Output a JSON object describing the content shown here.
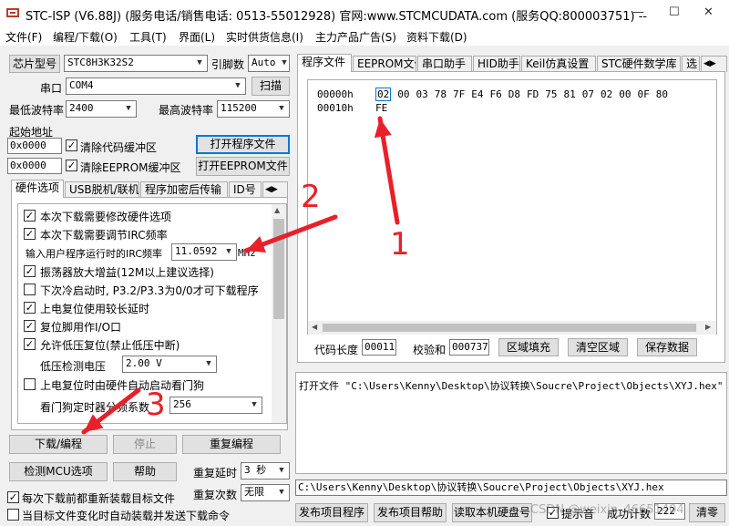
{
  "window": {
    "title": "STC-ISP (V6.88J) (服务电话/销售电话: 0513-55012928) 官网:www.STCMCUDATA.com (服务QQ:800003751) -- ",
    "minimize": "—",
    "maximize": "☐",
    "close": "✕"
  },
  "menu": [
    "文件(F)",
    "编程/下载(O)",
    "工具(T)",
    "界面(L)",
    "实时供货信息(I)",
    "主力产品广告(S)",
    "资料下载(D)"
  ],
  "left": {
    "chip_model_btn": "芯片型号",
    "chip_model_value": "STC8H3K32S2",
    "pin_count_label": "引脚数",
    "pin_count_value": "Auto",
    "port_label": "串口",
    "port_value": "COM4",
    "scan_btn": "扫描",
    "min_baud_label": "最低波特率",
    "min_baud_value": "2400",
    "max_baud_label": "最高波特率",
    "max_baud_value": "115200",
    "start_addr_label": "起始地址",
    "addr1": "0x0000",
    "clear_code_label": "清除代码缓冲区",
    "open_prog_btn": "打开程序文件",
    "addr2": "0x0000",
    "clear_eeprom_label": "清除EEPROM缓冲区",
    "open_eeprom_btn": "打开EEPROM文件",
    "tabs": [
      "硬件选项",
      "USB脱机/联机",
      "程序加密后传输",
      "ID号"
    ],
    "options": [
      {
        "label": "本次下载需要修改硬件选项",
        "checked": true
      },
      {
        "label": "本次下载需要调节IRC频率",
        "checked": true
      }
    ],
    "irc_label": "输入用户程序运行时的IRC频率",
    "irc_value": "11.0592",
    "irc_unit": "MHz",
    "options2": [
      {
        "label": "振荡器放大增益(12M以上建议选择)",
        "checked": true
      },
      {
        "label": "下次冷启动时, P3.2/P3.3为0/0才可下载程序",
        "checked": false
      },
      {
        "label": "上电复位使用较长延时",
        "checked": true
      },
      {
        "label": "复位脚用作I/O口",
        "checked": true
      },
      {
        "label": "允许低压复位(禁止低压中断)",
        "checked": true
      }
    ],
    "lvd_label": "低压检测电压",
    "lvd_value": "2.00 V",
    "wdt_option": {
      "label": "上电复位时由硬件自动启动看门狗",
      "checked": false
    },
    "wdt_div_label": "看门狗定时器分频系数",
    "wdt_div_value": "256",
    "download_btn": "下载/编程",
    "stop_btn": "停止",
    "reprogram_btn": "重复编程",
    "detect_btn": "检测MCU选项",
    "help_btn": "帮助",
    "repeat_delay_label": "重复延时",
    "repeat_delay_value": "3 秒",
    "repeat_count_label": "重复次数",
    "repeat_count_value": "无限",
    "reload_label": "每次下载前都重新装载目标文件",
    "auto_load_label": "当目标文件变化时自动装载并发送下载命令"
  },
  "right": {
    "tabs": [
      "程序文件",
      "EEPROM文件",
      "串口助手",
      "HID助手",
      "Keil仿真设置",
      "STC硬件数学库",
      "选"
    ],
    "hex_rows": [
      {
        "addr": "00000h",
        "bytes": [
          "02",
          "00",
          "03",
          "78",
          "7F",
          "E4",
          "F6",
          "D8",
          "FD",
          "75",
          "81",
          "07",
          "02",
          "00",
          "0F",
          "80"
        ]
      },
      {
        "addr": "00010h",
        "bytes": [
          "FE"
        ]
      }
    ],
    "code_len_label": "代码长度",
    "code_len_value": "00011",
    "checksum_label": "校验和",
    "checksum_value": "000737",
    "fill_btn": "区域填充",
    "clear_btn": "清空区域",
    "save_btn": "保存数据",
    "log_text": "打开文件 \"C:\\Users\\Kenny\\Desktop\\协议转换\\Soucre\\Project\\Objects\\XYJ.hex\" 成",
    "path_text": "C:\\Users\\Kenny\\Desktop\\协议转换\\Soucre\\Project\\Objects\\XYJ.hex",
    "publish_btn": "发布项目程序",
    "publish_help_btn": "发布项目帮助",
    "read_disk_btn": "读取本机硬盘号",
    "prompt_label": "提示音",
    "count_label": "成功计数",
    "count_value": "222",
    "clear_count_btn": "清零",
    "watermark": "CSDN @weixin_46651404"
  },
  "annotations": {
    "n1": "1",
    "n2": "2",
    "n3": "3",
    "color": "#e8202a"
  }
}
